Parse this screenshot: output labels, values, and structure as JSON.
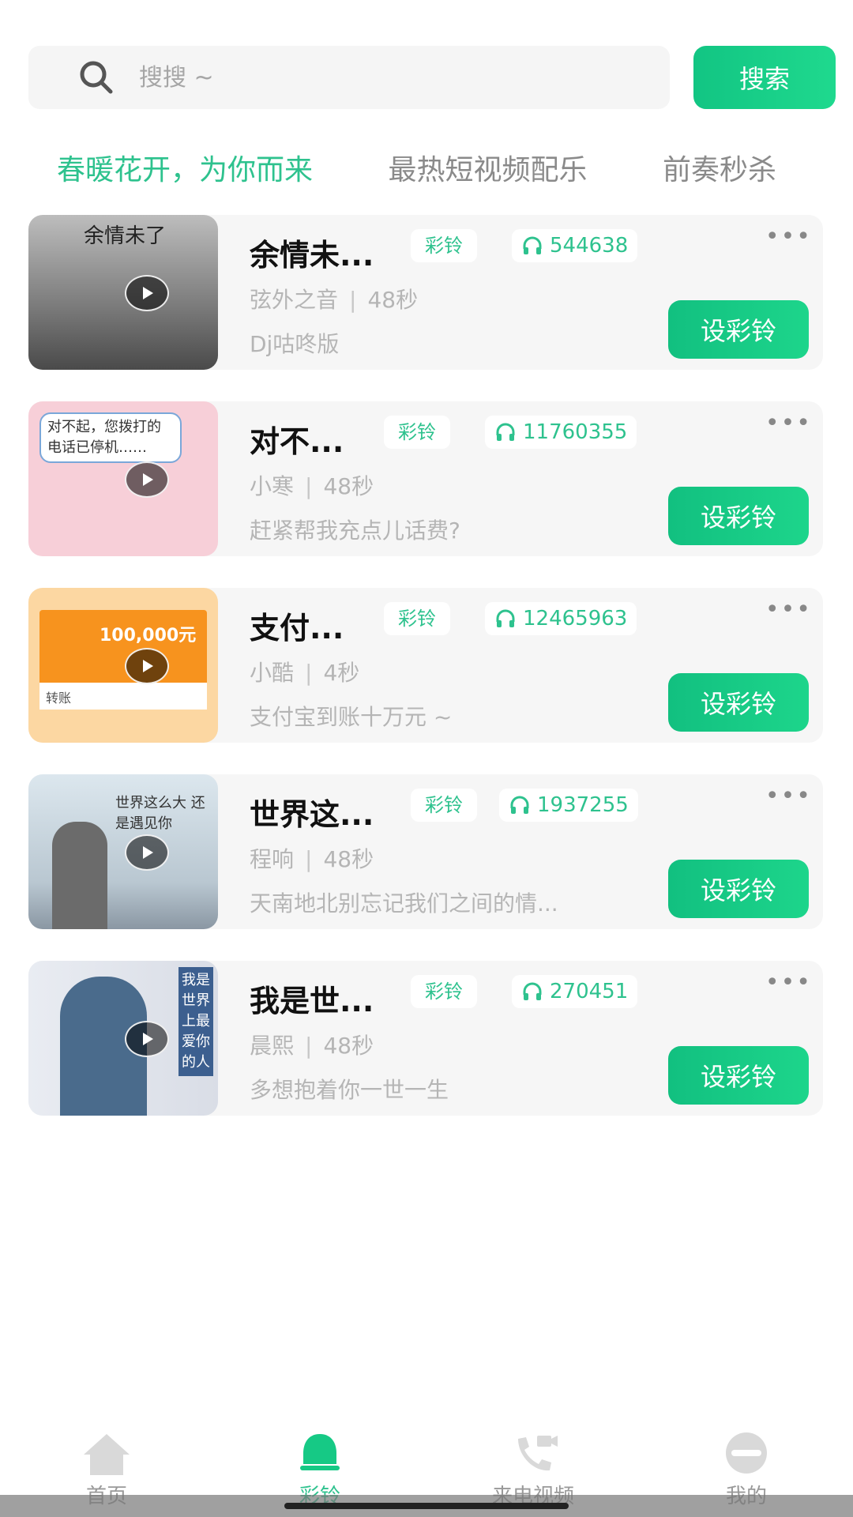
{
  "search": {
    "placeholder": "搜搜 ~",
    "button_label": "搜索"
  },
  "tabs": [
    {
      "label": "春暖花开，为你而来",
      "active": true
    },
    {
      "label": "最热短视频配乐",
      "active": false
    },
    {
      "label": "前奏秒杀",
      "active": false
    }
  ],
  "items": [
    {
      "title": "余情未...",
      "tag": "彩铃",
      "plays": "544638",
      "artist": "弦外之音",
      "duration": "48秒",
      "desc": "Dj咕咚版",
      "button": "设彩铃",
      "thumb_caption": "余情未了"
    },
    {
      "title": "对不...",
      "tag": "彩铃",
      "plays": "11760355",
      "artist": "小寒",
      "duration": "48秒",
      "desc": "赶紧帮我充点儿话费?",
      "button": "设彩铃",
      "thumb_caption": "对不起，您拨打的电话已停机……"
    },
    {
      "title": "支付...",
      "tag": "彩铃",
      "plays": "12465963",
      "artist": "小酷",
      "duration": "4秒",
      "desc": "支付宝到账十万元 ~",
      "button": "设彩铃",
      "thumb_caption": "100,000元"
    },
    {
      "title": "世界这...",
      "tag": "彩铃",
      "plays": "1937255",
      "artist": "程响",
      "duration": "48秒",
      "desc": "天南地北别忘记我们之间的情...",
      "button": "设彩铃",
      "thumb_caption": "世界这么大 还是遇见你"
    },
    {
      "title": "我是世...",
      "tag": "彩铃",
      "plays": "270451",
      "artist": "晨熙",
      "duration": "48秒",
      "desc": "多想抱着你一世一生",
      "button": "设彩铃",
      "thumb_caption": "我是世界上最爱你的人"
    }
  ],
  "item_extra": {
    "thumb_caption_2": "转账"
  },
  "more_label": "•••",
  "separator": "|",
  "nav": [
    {
      "label": "首页",
      "icon": "home-icon",
      "active": false
    },
    {
      "label": "彩铃",
      "icon": "bell-icon",
      "active": true
    },
    {
      "label": "来电视频",
      "icon": "video-call-icon",
      "active": false
    },
    {
      "label": "我的",
      "icon": "profile-icon",
      "active": false
    }
  ],
  "colors": {
    "accent": "#2ec28e",
    "button": "#16c985"
  }
}
